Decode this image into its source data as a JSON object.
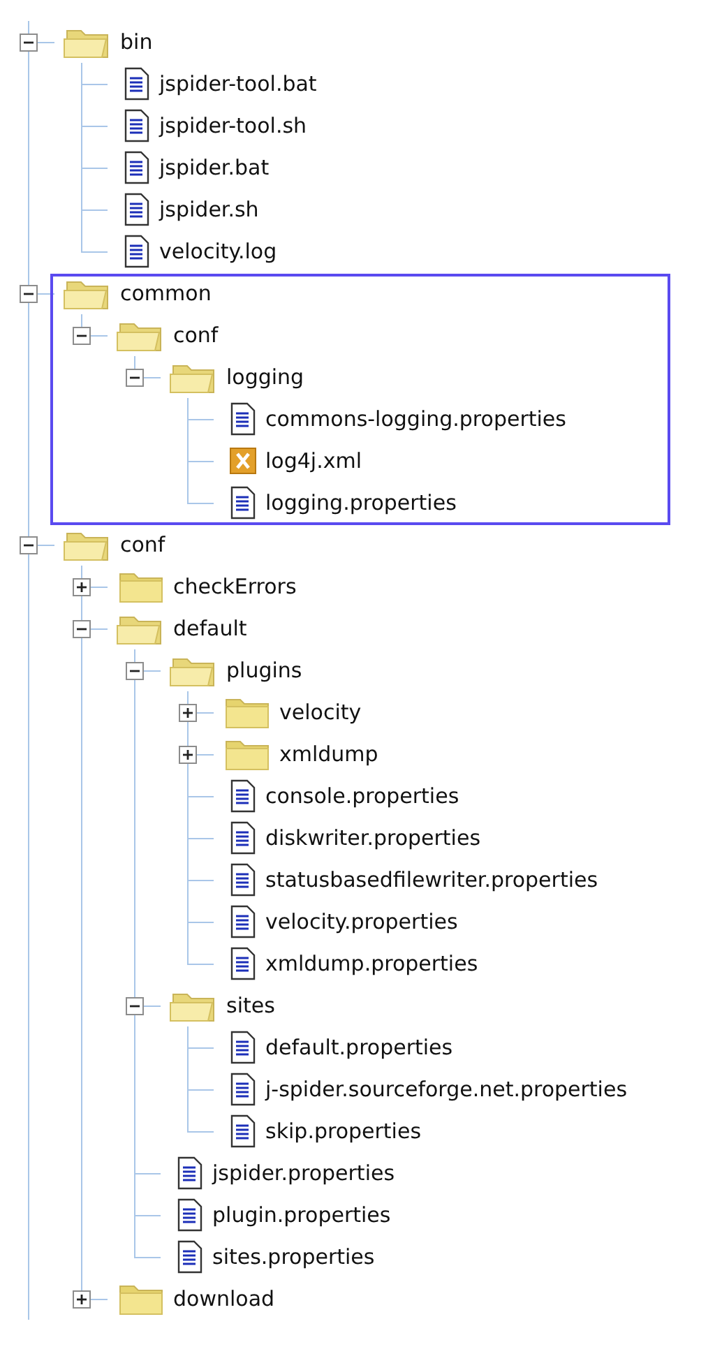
{
  "tree": [
    {
      "kind": "folder",
      "label": "bin",
      "expanded": true,
      "highlighted": false,
      "children": [
        {
          "kind": "file",
          "label": "jspider-tool.bat"
        },
        {
          "kind": "file",
          "label": "jspider-tool.sh"
        },
        {
          "kind": "file",
          "label": "jspider.bat"
        },
        {
          "kind": "file",
          "label": "jspider.sh"
        },
        {
          "kind": "file",
          "label": "velocity.log"
        }
      ]
    },
    {
      "kind": "folder",
      "label": "common",
      "expanded": true,
      "highlighted": true,
      "children": [
        {
          "kind": "folder",
          "label": "conf",
          "expanded": true,
          "highlighted": false,
          "children": [
            {
              "kind": "folder",
              "label": "logging",
              "expanded": true,
              "highlighted": false,
              "children": [
                {
                  "kind": "file",
                  "label": "commons-logging.properties"
                },
                {
                  "kind": "xml",
                  "label": "log4j.xml"
                },
                {
                  "kind": "file",
                  "label": "logging.properties"
                }
              ]
            }
          ]
        }
      ]
    },
    {
      "kind": "folder",
      "label": "conf",
      "expanded": true,
      "highlighted": false,
      "children": [
        {
          "kind": "folder",
          "label": "checkErrors",
          "expanded": false,
          "highlighted": false
        },
        {
          "kind": "folder",
          "label": "default",
          "expanded": true,
          "highlighted": false,
          "children": [
            {
              "kind": "folder",
              "label": "plugins",
              "expanded": true,
              "highlighted": false,
              "children": [
                {
                  "kind": "folder",
                  "label": "velocity",
                  "expanded": false,
                  "highlighted": false
                },
                {
                  "kind": "folder",
                  "label": "xmldump",
                  "expanded": false,
                  "highlighted": false
                },
                {
                  "kind": "file",
                  "label": "console.properties"
                },
                {
                  "kind": "file",
                  "label": "diskwriter.properties"
                },
                {
                  "kind": "file",
                  "label": "statusbasedfilewriter.properties"
                },
                {
                  "kind": "file",
                  "label": "velocity.properties"
                },
                {
                  "kind": "file",
                  "label": "xmldump.properties"
                }
              ]
            },
            {
              "kind": "folder",
              "label": "sites",
              "expanded": true,
              "highlighted": false,
              "children": [
                {
                  "kind": "file",
                  "label": "default.properties"
                },
                {
                  "kind": "file",
                  "label": "j-spider.sourceforge.net.properties"
                },
                {
                  "kind": "file",
                  "label": "skip.properties"
                }
              ]
            },
            {
              "kind": "file",
              "label": "jspider.properties"
            },
            {
              "kind": "file",
              "label": "plugin.properties"
            },
            {
              "kind": "file",
              "label": "sites.properties"
            }
          ]
        },
        {
          "kind": "folder",
          "label": "download",
          "expanded": false,
          "highlighted": false
        }
      ]
    }
  ]
}
